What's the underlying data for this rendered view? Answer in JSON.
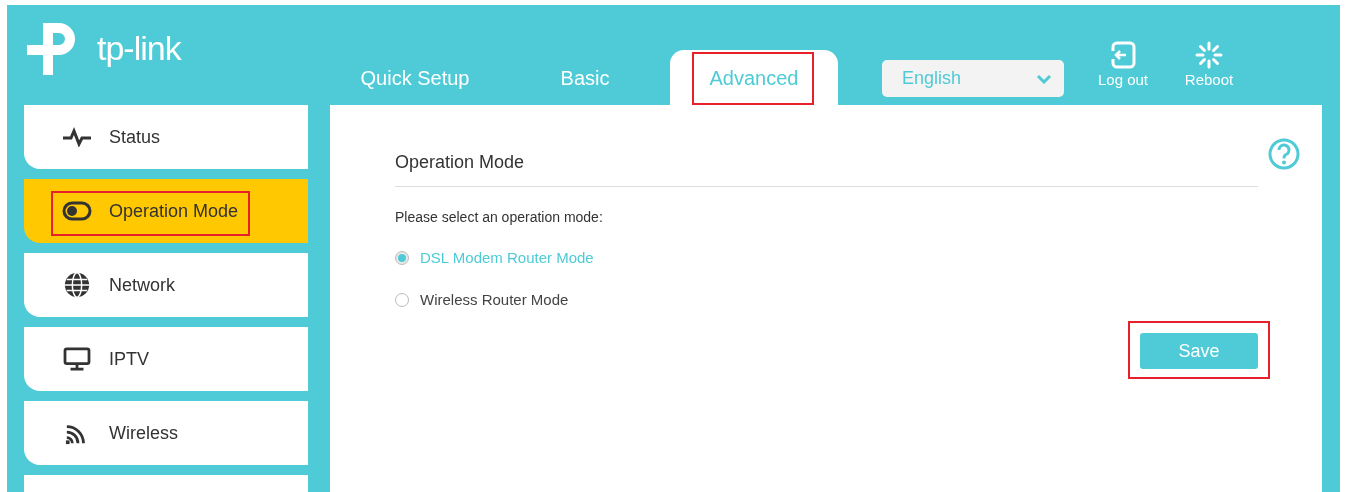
{
  "logo_text": "tp-link",
  "tabs": [
    {
      "label": "Quick Setup",
      "selected": false,
      "highlighted": false
    },
    {
      "label": "Basic",
      "selected": false,
      "highlighted": false
    },
    {
      "label": "Advanced",
      "selected": true,
      "highlighted": true
    }
  ],
  "language": {
    "value": "English"
  },
  "header_actions": [
    {
      "kind": "logout",
      "label": "Log out"
    },
    {
      "kind": "reboot",
      "label": "Reboot"
    }
  ],
  "sidebar": {
    "items": [
      {
        "kind": "status",
        "label": "Status",
        "selected": false,
        "highlighted": false
      },
      {
        "kind": "mode",
        "label": "Operation Mode",
        "selected": true,
        "highlighted": true
      },
      {
        "kind": "network",
        "label": "Network",
        "selected": false,
        "highlighted": false
      },
      {
        "kind": "iptv",
        "label": "IPTV",
        "selected": false,
        "highlighted": false
      },
      {
        "kind": "wireless",
        "label": "Wireless",
        "selected": false,
        "highlighted": false
      }
    ]
  },
  "panel": {
    "title": "Operation Mode",
    "prompt": "Please select an operation mode:",
    "options": [
      {
        "label": "DSL Modem Router Mode",
        "selected": true
      },
      {
        "label": "Wireless Router Mode",
        "selected": false
      }
    ],
    "save": {
      "label": "Save",
      "highlighted": true
    }
  }
}
